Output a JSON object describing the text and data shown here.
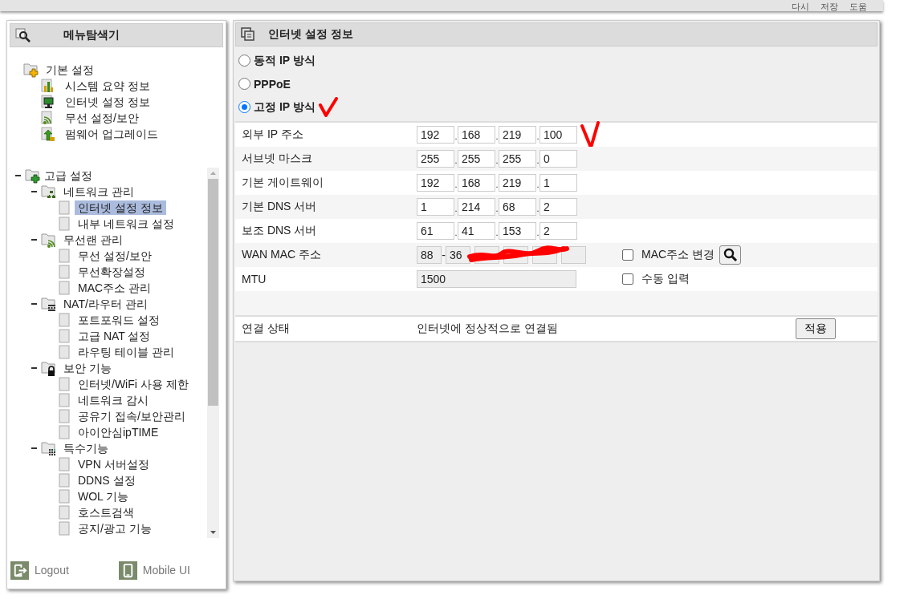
{
  "toolbar": [
    {
      "label": "다시"
    },
    {
      "label": "저장"
    },
    {
      "label": "도움"
    }
  ],
  "menu": {
    "title": "메뉴탐색기",
    "basic": {
      "label": "기본 설정",
      "children": [
        {
          "label": "시스템 요약 정보",
          "kind": "chart"
        },
        {
          "label": "인터넷 설정 정보",
          "kind": "monitor"
        },
        {
          "label": "무선 설정/보안",
          "kind": "wifi"
        },
        {
          "label": "펌웨어 업그레이드",
          "kind": "upload"
        }
      ]
    },
    "advanced": {
      "label": "고급 설정",
      "expanded": true,
      "children": [
        {
          "label": "네트워크 관리",
          "kind": "network",
          "expanded": true,
          "children": [
            {
              "label": "인터넷 설정 정보",
              "selected": true
            },
            {
              "label": "내부 네트워크 설정",
              "selected": false
            }
          ]
        },
        {
          "label": "무선랜 관리",
          "kind": "wifi",
          "expanded": true,
          "children": [
            {
              "label": "무선 설정/보안",
              "selected": false
            },
            {
              "label": "무선확장설정",
              "selected": false
            },
            {
              "label": "MAC주소 관리",
              "selected": false
            }
          ]
        },
        {
          "label": "NAT/라우터 관리",
          "kind": "router",
          "expanded": true,
          "children": [
            {
              "label": "포트포워드 설정",
              "selected": false
            },
            {
              "label": "고급 NAT 설정",
              "selected": false
            },
            {
              "label": "라우팅 테이블 관리",
              "selected": false
            }
          ]
        },
        {
          "label": "보안 기능",
          "kind": "lock",
          "expanded": true,
          "children": [
            {
              "label": "인터넷/WiFi 사용 제한",
              "selected": false
            },
            {
              "label": "네트워크 감시",
              "selected": false
            },
            {
              "label": "공유기 접속/보안관리",
              "selected": false
            },
            {
              "label": "아이안심ipTIME",
              "selected": false
            }
          ]
        },
        {
          "label": "특수기능",
          "kind": "grid",
          "expanded": true,
          "children": [
            {
              "label": "VPN 서버설정",
              "selected": false
            },
            {
              "label": "DDNS 설정",
              "selected": false
            },
            {
              "label": "WOL 기능",
              "selected": false
            },
            {
              "label": "호스트검색",
              "selected": false
            },
            {
              "label": "공지/광고 기능",
              "selected": false
            }
          ]
        }
      ]
    },
    "footer": [
      {
        "label": "Logout",
        "kind": "logout"
      },
      {
        "label": "Mobile UI",
        "kind": "mobile"
      }
    ]
  },
  "panel": {
    "title": "인터넷 설정 정보",
    "modes": [
      {
        "label": "동적 IP 방식",
        "selected": false
      },
      {
        "label": "PPPoE",
        "selected": false
      },
      {
        "label": "고정 IP 방식",
        "selected": true
      }
    ],
    "fields": [
      {
        "label": "외부 IP 주소",
        "kind": "ip",
        "separator": ".",
        "octets": [
          "192",
          "168",
          "219",
          "100"
        ]
      },
      {
        "label": "서브넷 마스크",
        "kind": "ip",
        "separator": ".",
        "octets": [
          "255",
          "255",
          "255",
          "0"
        ]
      },
      {
        "label": "기본 게이트웨이",
        "kind": "ip",
        "separator": ".",
        "octets": [
          "192",
          "168",
          "219",
          "1"
        ]
      },
      {
        "label": "기본 DNS 서버",
        "kind": "ip",
        "separator": ".",
        "octets": [
          "1",
          "214",
          "68",
          "2"
        ]
      },
      {
        "label": "보조 DNS 서버",
        "kind": "ip",
        "separator": ".",
        "octets": [
          "61",
          "41",
          "153",
          "2"
        ]
      },
      {
        "label": "WAN MAC 주소",
        "kind": "mac",
        "separator": "-",
        "octets": [
          "88",
          "36"
        ],
        "redacted": true,
        "lookup_button": true,
        "option": {
          "label": "MAC주소 변경",
          "checked": false
        }
      },
      {
        "label": "MTU",
        "kind": "text",
        "value": "1500",
        "disabled": true,
        "option": {
          "label": "수동 입력",
          "checked": false
        }
      }
    ],
    "status": {
      "label": "연결 상태",
      "value": "인터넷에 정상적으로 연결됨"
    },
    "apply_button": "적용"
  }
}
